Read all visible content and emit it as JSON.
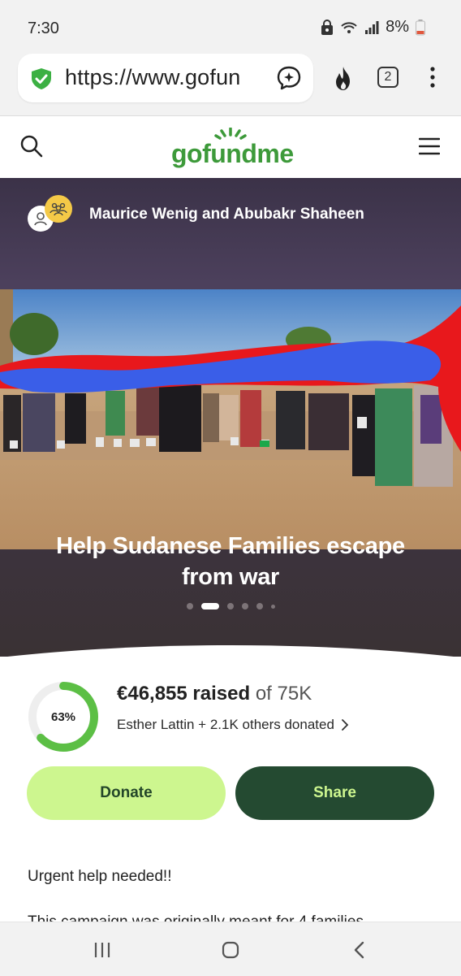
{
  "status_bar": {
    "time": "7:30",
    "battery": "8%"
  },
  "browser": {
    "url": "https://www.gofun",
    "tab_count": "2"
  },
  "site": {
    "logo": "gofundme"
  },
  "campaign": {
    "organizers": "Maurice Wenig and Abubakr Shaheen",
    "title": "Help Sudanese Families escape from war",
    "progress_percent": "63%",
    "progress_fraction": 0.63,
    "raised_amount": "€46,855 raised",
    "goal": "of 75K",
    "donors": "Esther Lattin + 2.1K others donated",
    "description_1": "Urgent help needed!!",
    "description_2": "This campaign was originally meant for 4 families"
  },
  "actions": {
    "donate": "Donate",
    "share": "Share"
  },
  "colors": {
    "brand_green": "#3d9a3a",
    "donate_bg": "#cdf68f",
    "share_bg": "#244a31"
  },
  "icons": [
    "shield-check-icon",
    "assistant-icon",
    "flame-icon",
    "more-icon",
    "search-icon",
    "menu-icon",
    "user-icon",
    "team-icon",
    "chevron-right-icon",
    "recents-icon",
    "home-icon",
    "back-icon"
  ]
}
